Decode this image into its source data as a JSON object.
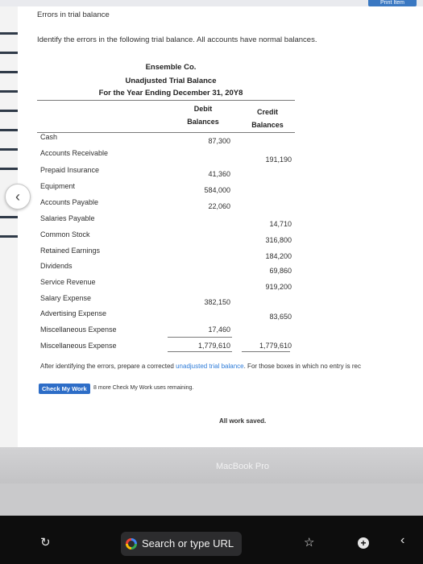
{
  "header": {
    "print_label": "Print Item"
  },
  "section_title": "Errors in trial balance",
  "instructions": "Identify the errors in the following trial balance. All accounts have normal balances.",
  "statement": {
    "company": "Ensemble Co.",
    "title": "Unadjusted Trial Balance",
    "period": "For the Year Ending December 31, 20Y8",
    "debit_header_1": "Debit",
    "debit_header_2": "Balances",
    "credit_header_1": "Credit",
    "credit_header_2": "Balances",
    "rows": [
      {
        "account": "Cash",
        "debit": "87,300",
        "credit": ""
      },
      {
        "account": "Accounts Receivable",
        "debit": "",
        "credit": "191,190"
      },
      {
        "account": "Prepaid Insurance",
        "debit": "41,360",
        "credit": ""
      },
      {
        "account": "Equipment",
        "debit": "584,000",
        "credit": ""
      },
      {
        "account": "Accounts Payable",
        "debit": "22,060",
        "credit": ""
      },
      {
        "account": "Salaries Payable",
        "debit": "",
        "credit": "14,710"
      },
      {
        "account": "Common Stock",
        "debit": "",
        "credit": "316,800"
      },
      {
        "account": "Retained Earnings",
        "debit": "",
        "credit": "184,200"
      },
      {
        "account": "Dividends",
        "debit": "",
        "credit": "69,860"
      },
      {
        "account": "Service Revenue",
        "debit": "",
        "credit": "919,200"
      },
      {
        "account": "Salary Expense",
        "debit": "382,150",
        "credit": ""
      },
      {
        "account": "Advertising Expense",
        "debit": "",
        "credit": "83,650"
      },
      {
        "account": "Miscellaneous Expense",
        "debit": "17,460",
        "credit": ""
      },
      {
        "account": "Miscellaneous Expense",
        "debit": "1,779,610",
        "credit": "1,779,610"
      }
    ]
  },
  "after_text_before": "After identifying the errors, prepare a corrected ",
  "after_text_link": "unadjusted trial balance",
  "after_text_after": ". For those boxes in which no entry is rec",
  "check_button": "Check My Work",
  "remaining": "8 more Check My Work uses remaining.",
  "saved": "All work saved.",
  "bezel_label": "MacBook Pro",
  "touchbar": {
    "search_label": "Search or type URL",
    "reload_icon": "reload-icon",
    "star_icon": "star-icon",
    "plus_icon": "plus-icon",
    "chevron_icon": "chevron-left-icon"
  }
}
